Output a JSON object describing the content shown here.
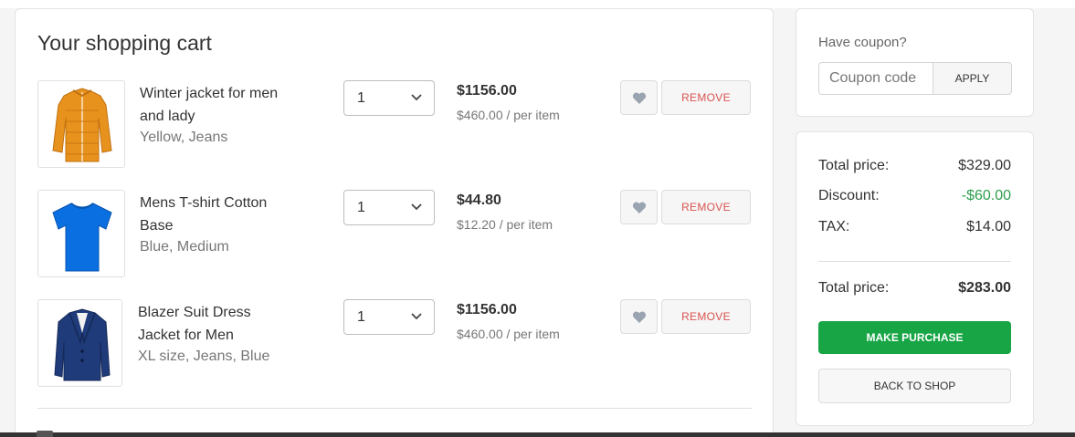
{
  "cart": {
    "title": "Your shopping cart",
    "items": [
      {
        "name": "Winter jacket for men and lady",
        "variant": "Yellow, Jeans",
        "quantity": "1",
        "price_total": "$1156.00",
        "price_each": "$460.00 / per item",
        "remove_label": "REMOVE",
        "thumb_icon": "puffer-jacket-icon",
        "thumb_color": "#e8921e"
      },
      {
        "name": "Mens T-shirt Cotton Base",
        "variant": "Blue, Medium",
        "quantity": "1",
        "price_total": "$44.80",
        "price_each": "$12.20 / per item",
        "remove_label": "REMOVE",
        "thumb_icon": "tshirt-icon",
        "thumb_color": "#0a6fe0"
      },
      {
        "name": "Blazer Suit Dress Jacket for Men",
        "variant": "XL size, Jeans, Blue",
        "quantity": "1",
        "price_total": "$1156.00",
        "price_each": "$460.00 / per item",
        "remove_label": "REMOVE",
        "thumb_icon": "blazer-icon",
        "thumb_color": "#1f3b7a"
      }
    ]
  },
  "coupon": {
    "label": "Have coupon?",
    "placeholder": "Coupon code",
    "apply_label": "APPLY"
  },
  "summary": {
    "total_price_label": "Total price:",
    "total_price_value": "$329.00",
    "discount_label": "Discount:",
    "discount_value": "-$60.00",
    "tax_label": "TAX:",
    "tax_value": "$14.00",
    "final_label": "Total price:",
    "final_value": "$283.00",
    "purchase_label": "MAKE PURCHASE",
    "back_label": "BACK TO SHOP"
  },
  "colors": {
    "accent_green": "#17a545",
    "discount_green": "#2e9e4f",
    "remove_red": "#d9534f",
    "heart_gray": "#9aa3b0"
  }
}
